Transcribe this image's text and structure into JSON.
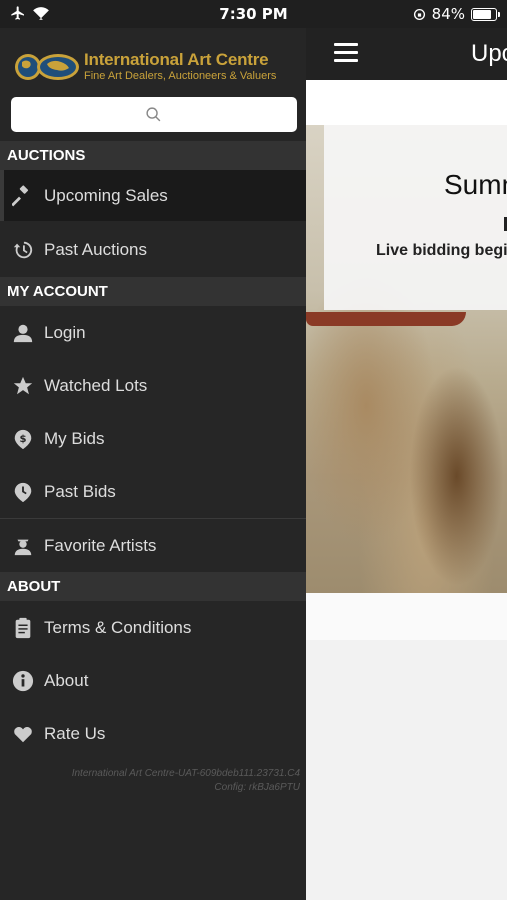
{
  "status_bar": {
    "time": "7:30 PM",
    "battery": "84%",
    "battery_level": 0.84
  },
  "main": {
    "nav_title": "Upcoming Sales",
    "banner_title": "Summer",
    "banner_subtitle": "Live bidding begins"
  },
  "drawer": {
    "logo_name": "International Art Centre",
    "logo_tagline": "Fine Art Dealers, Auctioneers & Valuers",
    "search_placeholder": "",
    "sections": {
      "auctions": "AUCTIONS",
      "my_account": "MY ACCOUNT",
      "about": "ABOUT"
    },
    "items": {
      "upcoming_sales": "Upcoming Sales",
      "past_auctions": "Past Auctions",
      "login": "Login",
      "watched_lots": "Watched Lots",
      "my_bids": "My Bids",
      "past_bids": "Past Bids",
      "favorite_artists": "Favorite Artists",
      "terms": "Terms & Conditions",
      "about": "About",
      "rate_us": "Rate Us"
    },
    "version_line1": "International Art Centre-UAT-609bdeb111.23731.C4",
    "version_line2": "Config: rkBJa6PTU"
  },
  "colors": {
    "accent_gold": "#c9a23a",
    "drawer_bg": "#262626",
    "section_bg": "#333333"
  }
}
